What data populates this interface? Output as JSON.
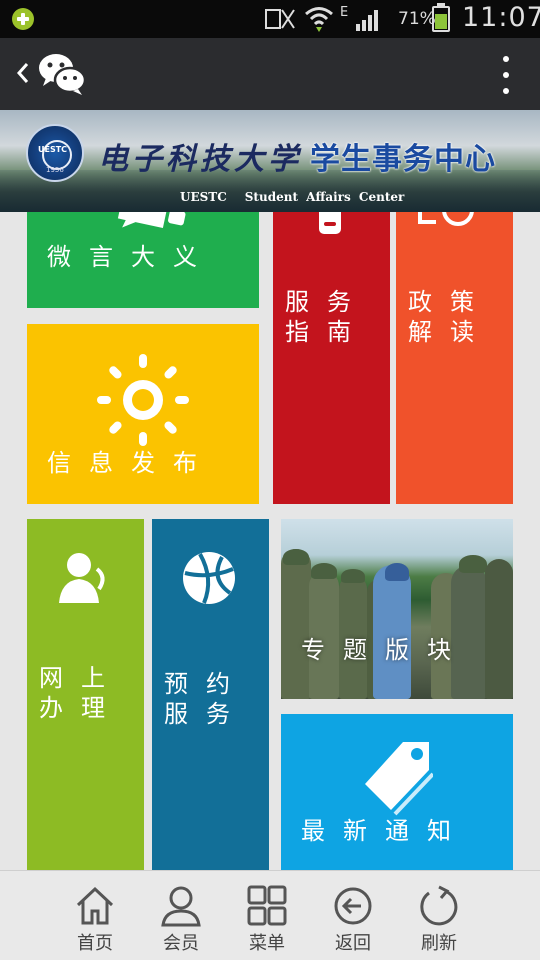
{
  "status_bar": {
    "battery_percent": "71%",
    "battery_level": 0.71,
    "time": "11:07",
    "network_type": "E",
    "icons": [
      "app-badge-icon",
      "no-sim-icon",
      "wifi-icon",
      "signal-icon",
      "battery-icon"
    ]
  },
  "header": {
    "icons": [
      "back-chevron-icon",
      "wechat-logo-icon",
      "more-vertical-icon"
    ]
  },
  "banner": {
    "cn_name": "电子科技大学",
    "center_name": "学生事务中心",
    "en_school": "UESTC",
    "en_center": "Student Affairs Center",
    "emblem_text": "UESTC",
    "emblem_year": "1956"
  },
  "tiles": {
    "wei": {
      "label": "微言大义",
      "color": "#1fae4e"
    },
    "fuwu": {
      "line1": "服务",
      "line2": "指南",
      "color": "#c3141d"
    },
    "zheng": {
      "line1": "政策",
      "line2": "解读",
      "color": "#f0522b"
    },
    "xinxi": {
      "label": "信息发布",
      "color": "#fbc300"
    },
    "wang": {
      "line1": "网上",
      "line2": "办理",
      "color": "#8dbb24"
    },
    "yuyue": {
      "line1": "预约",
      "line2": "服务",
      "color": "#126f98"
    },
    "zhuanti": {
      "label": "专题版块"
    },
    "zuixin": {
      "label": "最新通知",
      "color": "#0ea4e3"
    }
  },
  "bottom_nav": [
    {
      "label": "首页",
      "icon": "home-icon"
    },
    {
      "label": "会员",
      "icon": "user-icon"
    },
    {
      "label": "菜单",
      "icon": "grid-menu-icon"
    },
    {
      "label": "返回",
      "icon": "back-circle-icon"
    },
    {
      "label": "刷新",
      "icon": "refresh-icon"
    }
  ]
}
